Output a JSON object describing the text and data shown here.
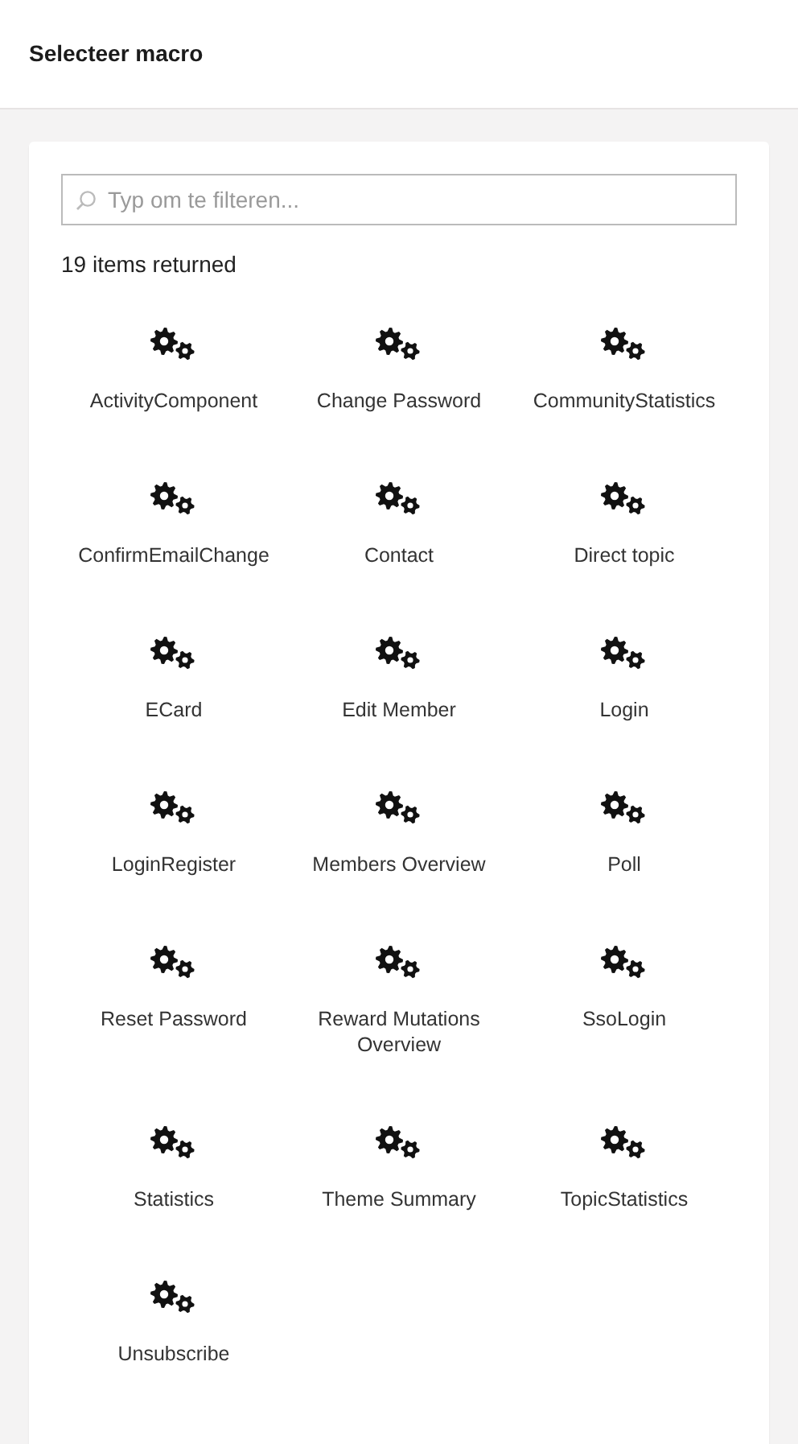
{
  "header": {
    "title": "Selecteer macro"
  },
  "search": {
    "placeholder": "Typ om te filteren..."
  },
  "result_count": "19 items returned",
  "macros": [
    {
      "label": "ActivityComponent"
    },
    {
      "label": "Change Password"
    },
    {
      "label": "CommunityStatistics"
    },
    {
      "label": "ConfirmEmailChange"
    },
    {
      "label": "Contact"
    },
    {
      "label": "Direct topic"
    },
    {
      "label": "ECard"
    },
    {
      "label": "Edit Member"
    },
    {
      "label": "Login"
    },
    {
      "label": "LoginRegister"
    },
    {
      "label": "Members Overview"
    },
    {
      "label": "Poll"
    },
    {
      "label": "Reset Password"
    },
    {
      "label": "Reward Mutations Overview"
    },
    {
      "label": "SsoLogin"
    },
    {
      "label": "Statistics"
    },
    {
      "label": "Theme Summary"
    },
    {
      "label": "TopicStatistics"
    },
    {
      "label": "Unsubscribe"
    }
  ]
}
